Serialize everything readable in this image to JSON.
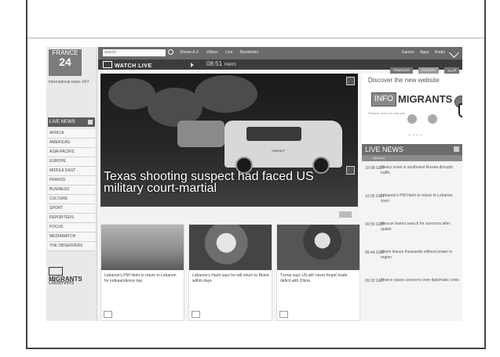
{
  "sidebar": {
    "logo_top": "FRANCE",
    "logo_num": "24",
    "tagline": "International news 24/7",
    "live_label": "LIVE NEWS",
    "nav": [
      "AFRICA",
      "AMERICAS",
      "ASIA-PACIFIC",
      "EUROPE",
      "MIDDLE EAST",
      "FRANCE",
      "BUSINESS",
      "CULTURE",
      "SPORT",
      "REPORTERS",
      "FOCUS",
      "MEDIAWATCH",
      "THE OBSERVERS"
    ],
    "brand1": "MIGRANTS",
    "brand2": "Observers"
  },
  "topbar": {
    "search_placeholder": "search",
    "links": [
      "Shows A-Z",
      "Videos",
      "Live",
      "Newsletter"
    ],
    "right_links": [
      "Games",
      "Apps",
      "Radio"
    ]
  },
  "bar2": {
    "watch_label": "WATCH LIVE",
    "time": "08:51",
    "time_suffix": "PARIS"
  },
  "lang": [
    "FRANÇAIS",
    "ENGLISH",
    "العربية"
  ],
  "hero": {
    "caption": "Texas shooting suspect had faced US military court-martial",
    "car_text": "SHERIFF"
  },
  "cards": [
    {
      "caption": "Lebanon's PM Hariri to return to Lebanon for independence day"
    },
    {
      "caption": "Lebanon's Hariri says he will return to Beirut within days"
    },
    {
      "caption": "Trump says US will 'never forget' trade deficit with China"
    }
  ],
  "promo": {
    "title": "Discover the new website",
    "info": "INFO",
    "migrants": "MIGRANTS",
    "sub": "Reliable news for migrants"
  },
  "live_news": {
    "title": "LIVE NEWS",
    "sub": "Updated",
    "items": [
      {
        "time": "10:08 GMT",
        "text": "Heavy snow in southwest Russia disrupts traffic"
      },
      {
        "time": "10:05 GMT",
        "text": "Lebanon's PM Hariri to return to Lebanon soon"
      },
      {
        "time": "09:55 GMT",
        "text": "Rescue teams search for survivors after quake"
      },
      {
        "time": "09:44 GMT",
        "text": "Storm leaves thousands without power in region"
      },
      {
        "time": "09:32 GMT",
        "text": "France raises concerns over diplomatic crisis"
      }
    ]
  }
}
